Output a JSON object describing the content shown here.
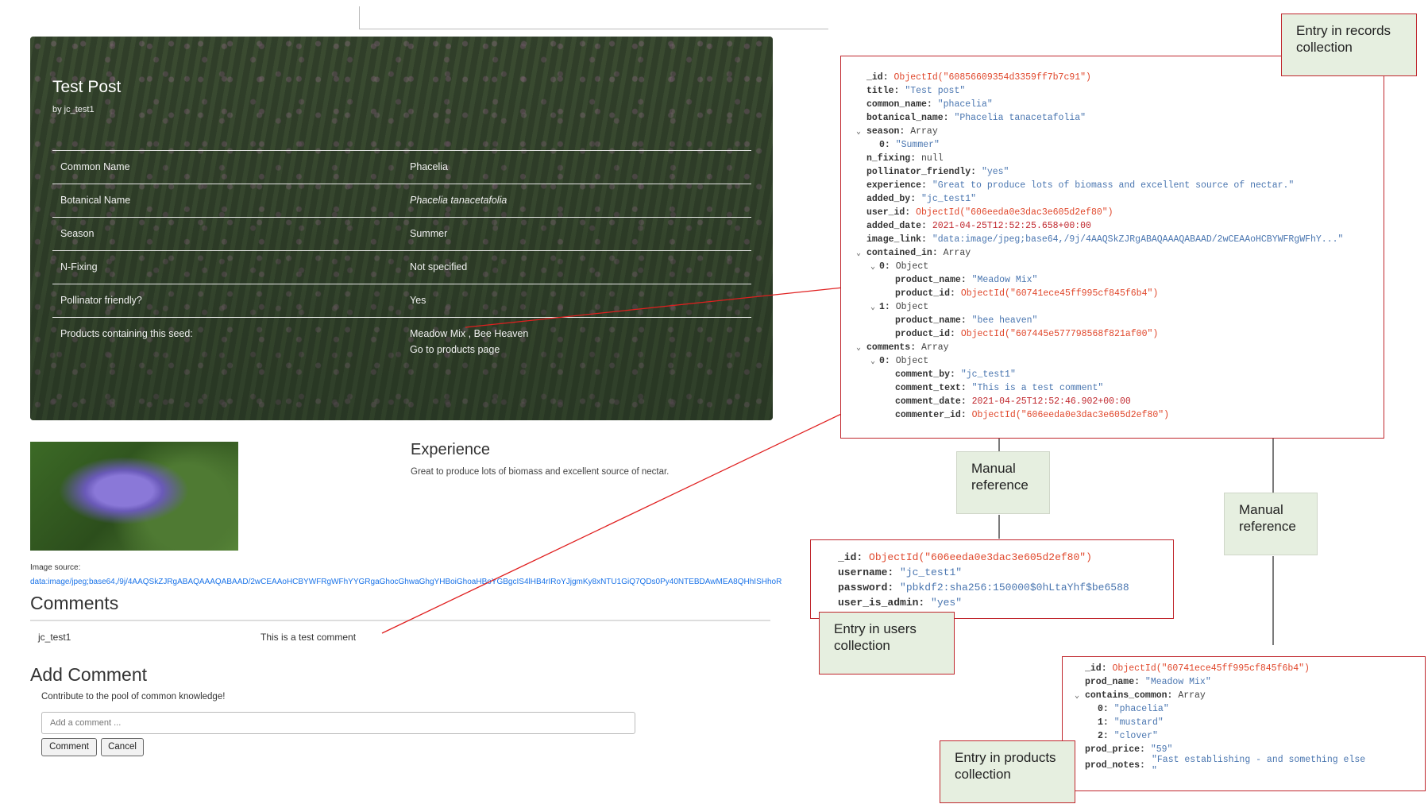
{
  "app": {
    "post_title": "Test Post",
    "post_by": "by jc_test1",
    "rows": [
      {
        "key": "Common Name",
        "value": "Phacelia"
      },
      {
        "key": "Botanical Name",
        "value": "Phacelia tanacetafolia"
      },
      {
        "key": "Season",
        "value": "Summer"
      },
      {
        "key": "N-Fixing",
        "value": "Not specified"
      },
      {
        "key": "Pollinator friendly?",
        "value": "Yes"
      },
      {
        "key": "Products containing this seed:",
        "value": "Meadow Mix , Bee Heaven",
        "value2": "Go to products page"
      }
    ],
    "experience_title": "Experience",
    "experience_text": "Great to produce lots of biomass and excellent source of nectar.",
    "image_source_label": "Image source:",
    "image_source_link": "data:image/jpeg;base64,/9j/4AAQSkZJRgABAQAAAQABAAD/2wCEAAoHCBYWFRgWFhYYGRgaGhocGhwaGhgYHBoiGhoaHBoYGBgcIS4lHB4rIRoYJjgmKy8xNTU1GiQ7QDs0Py40NTEBDAwMEA8QHhISHhoR",
    "comments_title": "Comments",
    "comment_user": "jc_test1",
    "comment_text": "This is a test comment",
    "add_comment_title": "Add Comment",
    "add_comment_subtitle": "Contribute to the pool of common knowledge!",
    "add_comment_placeholder": "Add a comment ...",
    "comment_button": "Comment",
    "cancel_button": "Cancel"
  },
  "labels": {
    "records": "Entry in records collection",
    "users": "Entry in users collection",
    "products": "Entry in products collection",
    "manual_ref_1": "Manual reference",
    "manual_ref_2": "Manual reference"
  },
  "records_doc": {
    "id": "ObjectId(\"60856609354d3359ff7b7c91\")",
    "title": "\"Test post\"",
    "common_name": "\"phacelia\"",
    "botanical_name": "\"Phacelia tanacetafolia\"",
    "season_type": "Array",
    "season_0": "\"Summer\"",
    "n_fixing": "null",
    "pollinator_friendly": "\"yes\"",
    "experience": "\"Great to produce lots of biomass and excellent source of nectar.\"",
    "added_by": "\"jc_test1\"",
    "user_id": "ObjectId(\"606eeda0e3dac3e605d2ef80\")",
    "added_date": "2021-04-25T12:52:25.658+00:00",
    "image_link": "\"data:image/jpeg;base64,/9j/4AAQSkZJRgABAQAAAQABAAD/2wCEAAoHCBYWFRgWFhY...\"",
    "contained_in_type": "Array",
    "obj_type": "Object",
    "ci0_product_name": "\"Meadow Mix\"",
    "ci0_product_id": "ObjectId(\"60741ece45ff995cf845f6b4\")",
    "ci1_product_name": "\"bee heaven\"",
    "ci1_product_id": "ObjectId(\"607445e577798568f821af00\")",
    "comments_type": "Array",
    "c0_comment_by": "\"jc_test1\"",
    "c0_comment_text": "\"This is a test comment\"",
    "c0_comment_date": "2021-04-25T12:52:46.902+00:00",
    "c0_commenter_id": "ObjectId(\"606eeda0e3dac3e605d2ef80\")"
  },
  "users_doc": {
    "id": "ObjectId(\"606eeda0e3dac3e605d2ef80\")",
    "username": "\"jc_test1\"",
    "password": "\"pbkdf2:sha256:150000$0hLtaYhf$be6588",
    "user_is_admin": "\"yes\""
  },
  "products_doc": {
    "id": "ObjectId(\"60741ece45ff995cf845f6b4\")",
    "prod_name": "\"Meadow Mix\"",
    "contains_common_type": "Array",
    "cc0": "\"phacelia\"",
    "cc1": "\"mustard\"",
    "cc2": "\"clover\"",
    "prod_price": "\"59\"",
    "prod_notes_1": "\"Fast establishing - and something else",
    "prod_notes_2": "\""
  },
  "colors": {
    "box_border": "#c0272d",
    "label_fill": "#e6efe0",
    "arrow": "#e02020",
    "connector": "#333333"
  }
}
